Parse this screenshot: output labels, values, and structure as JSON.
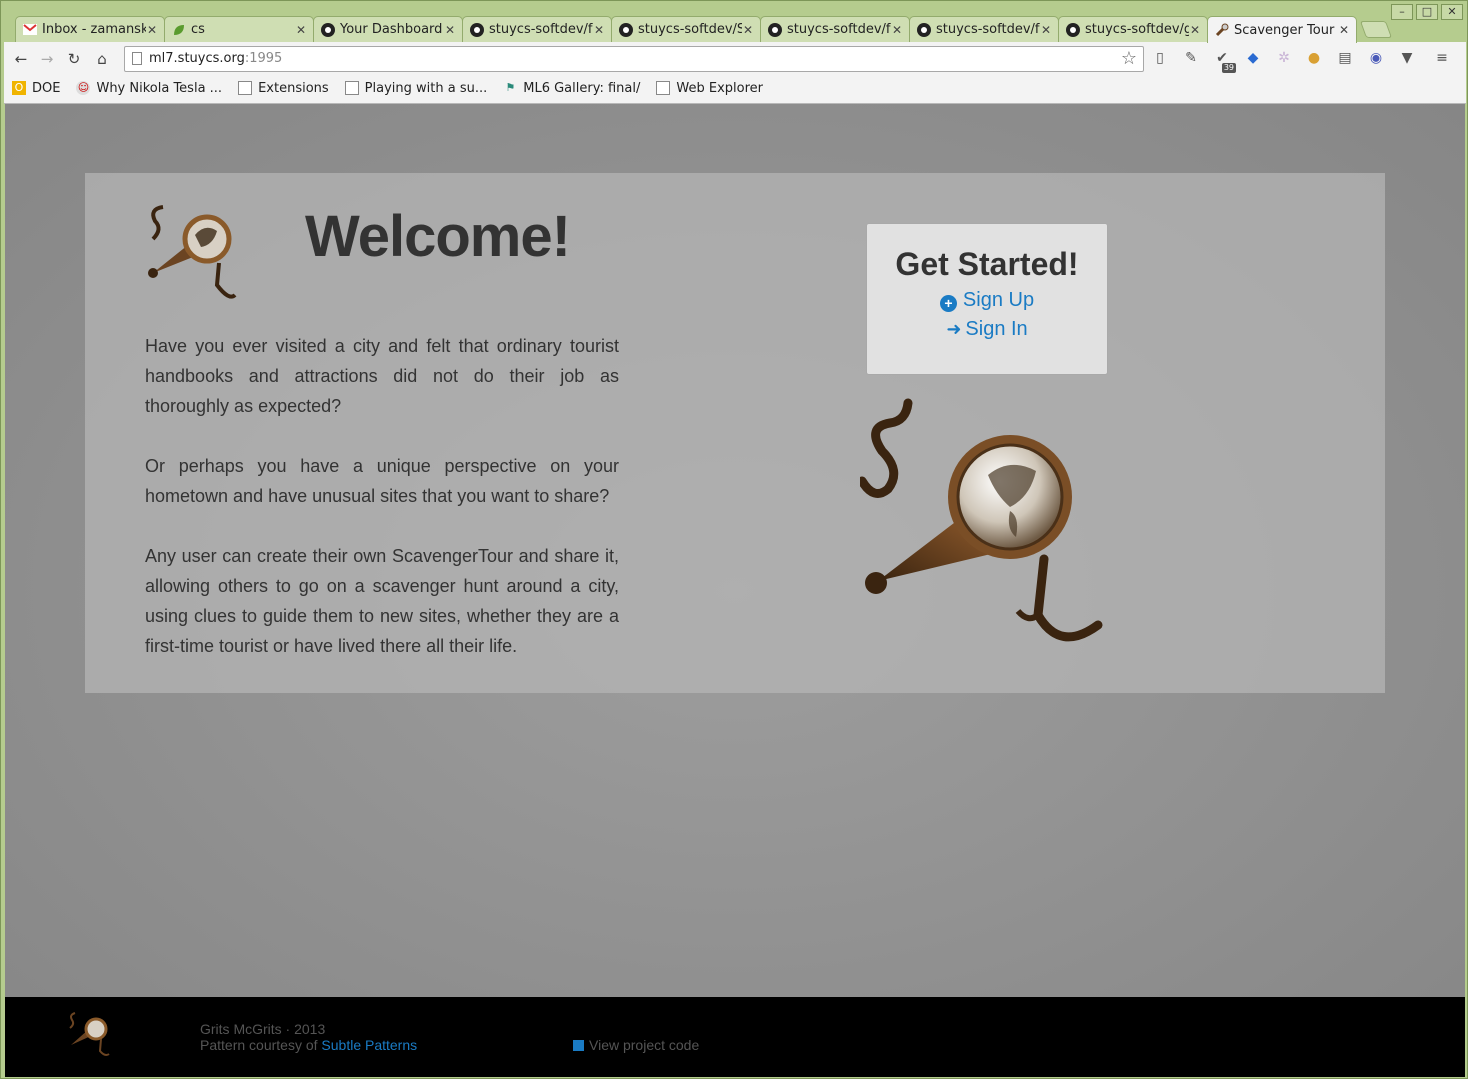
{
  "browser": {
    "tabs": [
      {
        "title": "Inbox - zamansky",
        "icon": "gmail-icon"
      },
      {
        "title": "cs",
        "icon": "green-leaf-icon"
      },
      {
        "title": "Your Dashboard",
        "icon": "github-icon"
      },
      {
        "title": "stuycs-softdev/f",
        "icon": "github-icon"
      },
      {
        "title": "stuycs-softdev/S",
        "icon": "github-icon"
      },
      {
        "title": "stuycs-softdev/f",
        "icon": "github-icon"
      },
      {
        "title": "stuycs-softdev/f",
        "icon": "github-icon"
      },
      {
        "title": "stuycs-softdev/g",
        "icon": "github-icon"
      },
      {
        "title": "Scavenger Tour",
        "icon": "telescope-icon"
      }
    ],
    "url_host": "ml7.stuycs.org",
    "url_port": ":1995",
    "extension_badge": "39",
    "bookmarks": [
      {
        "label": "DOE"
      },
      {
        "label": "Why Nikola Tesla ..."
      },
      {
        "label": "Extensions"
      },
      {
        "label": "Playing with a su..."
      },
      {
        "label": "ML6 Gallery: final/"
      },
      {
        "label": "Web Explorer"
      }
    ]
  },
  "page": {
    "heading": "Welcome!",
    "paragraphs": [
      "Have you ever visited a city and felt that ordinary tourist handbooks and attractions did not do their job as thoroughly as expected?",
      "Or perhaps you have a unique perspective on your hometown and have unusual sites that you want to share?",
      "Any user can create their own ScavengerTour and share it, allowing others to go on a scavenger hunt around a city, using clues to guide them to new sites, whether they are a first-time tourist or have lived there all their life."
    ],
    "get_started": {
      "title": "Get Started!",
      "signup": "Sign Up",
      "signin": "Sign In"
    },
    "footer": {
      "credit": "Grits McGrits · 2013",
      "pattern_prefix": "Pattern courtesy of ",
      "pattern_link": "Subtle Patterns",
      "code_link": "View project code"
    }
  },
  "colors": {
    "link": "#1a7bc4",
    "chrome": "#b5cc8e",
    "page_bg": "#8f8f8f"
  }
}
